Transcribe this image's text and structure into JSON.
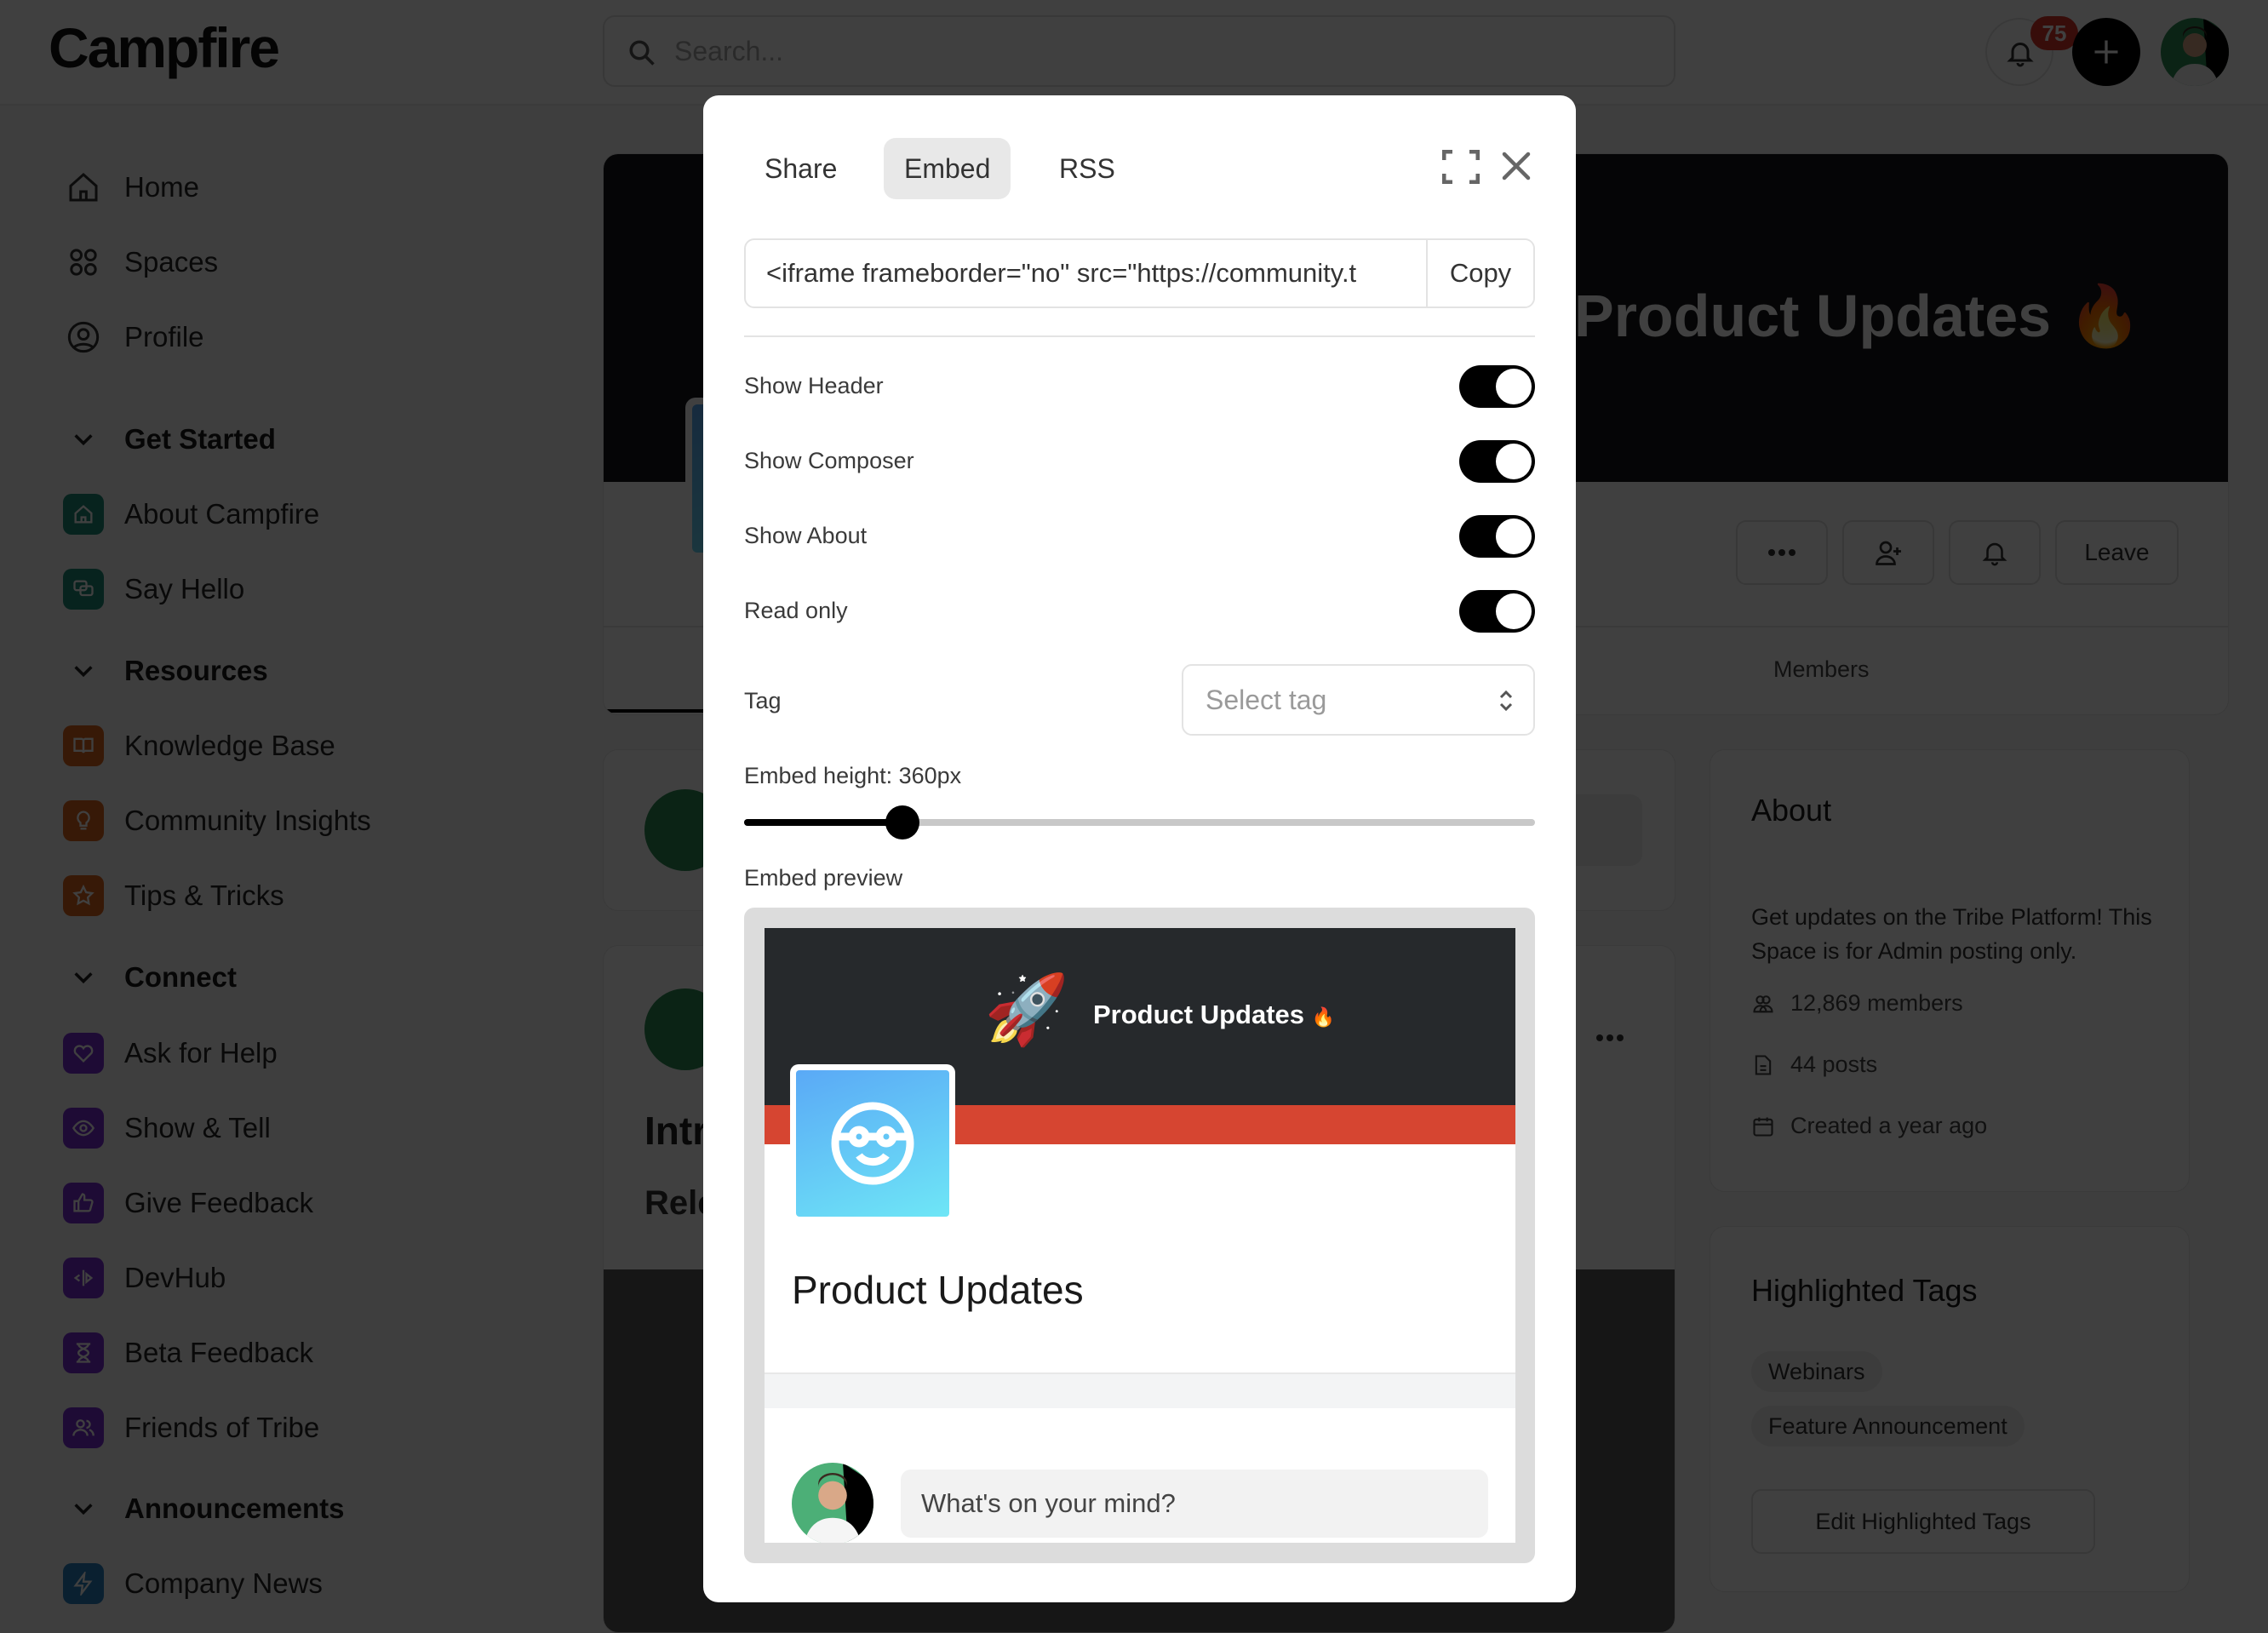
{
  "app": {
    "logo": "Campfire"
  },
  "topbar": {
    "search_placeholder": "Search...",
    "notifications_count": "75"
  },
  "sidebar": {
    "nav": [
      {
        "label": "Home",
        "icon": "home-icon"
      },
      {
        "label": "Spaces",
        "icon": "spaces-icon"
      },
      {
        "label": "Profile",
        "icon": "profile-icon"
      }
    ],
    "groups": [
      {
        "title": "Get Started",
        "items": [
          {
            "label": "About Campfire",
            "icon": "house-icon",
            "color": "#1f8a78"
          },
          {
            "label": "Say Hello",
            "icon": "chat-icon",
            "color": "#1f8a78"
          }
        ]
      },
      {
        "title": "Resources",
        "items": [
          {
            "label": "Knowledge Base",
            "icon": "book-icon",
            "color": "#d9641c"
          },
          {
            "label": "Community Insights",
            "icon": "lightbulb-icon",
            "color": "#d9641c"
          },
          {
            "label": "Tips & Tricks",
            "icon": "star-icon",
            "color": "#d9641c"
          }
        ]
      },
      {
        "title": "Connect",
        "items": [
          {
            "label": "Ask for Help",
            "icon": "heart-icon",
            "color": "#7a2fd1"
          },
          {
            "label": "Show & Tell",
            "icon": "eye-icon",
            "color": "#7a2fd1"
          },
          {
            "label": "Give Feedback",
            "icon": "thumbs-up-icon",
            "color": "#7a2fd1"
          },
          {
            "label": "DevHub",
            "icon": "code-icon",
            "color": "#7a2fd1"
          },
          {
            "label": "Beta Feedback",
            "icon": "hourglass-icon",
            "color": "#7a2fd1"
          },
          {
            "label": "Friends of Tribe",
            "icon": "users-icon",
            "color": "#7a2fd1"
          }
        ]
      },
      {
        "title": "Announcements",
        "items": [
          {
            "label": "Company News",
            "icon": "bolt-icon",
            "color": "#2a7fc0"
          }
        ]
      }
    ]
  },
  "space": {
    "banner_title": "Product Updates",
    "leave_label": "Leave",
    "tabs": {
      "members": "Members"
    },
    "feed": {
      "post_title_partial": "Intr",
      "post_subtitle_partial": "Rele"
    }
  },
  "about": {
    "title": "About",
    "description": "Get updates on the Tribe Platform! This Space is for Admin posting only.",
    "members": "12,869 members",
    "posts": "44 posts",
    "created": "Created a year ago"
  },
  "highlighted_tags": {
    "title": "Highlighted Tags",
    "tags": [
      "Webinars",
      "Feature Announcement"
    ],
    "edit_label": "Edit Highlighted Tags"
  },
  "modal": {
    "tabs": [
      {
        "label": "Share",
        "active": false
      },
      {
        "label": "Embed",
        "active": true
      },
      {
        "label": "RSS",
        "active": false
      }
    ],
    "embed_code": "<iframe frameborder=\"no\" src=\"https://community.t",
    "copy_label": "Copy",
    "options": [
      {
        "label": "Show Header",
        "on": true
      },
      {
        "label": "Show Composer",
        "on": true
      },
      {
        "label": "Show About",
        "on": true
      },
      {
        "label": "Read only",
        "on": true
      }
    ],
    "tag_label": "Tag",
    "tag_placeholder": "Select tag",
    "embed_height_label": "Embed height: 360px",
    "embed_height_fraction": 0.2,
    "preview_label": "Embed preview",
    "preview": {
      "banner_title": "Product Updates",
      "space_title": "Product Updates",
      "composer_placeholder": "What's on your mind?"
    }
  }
}
